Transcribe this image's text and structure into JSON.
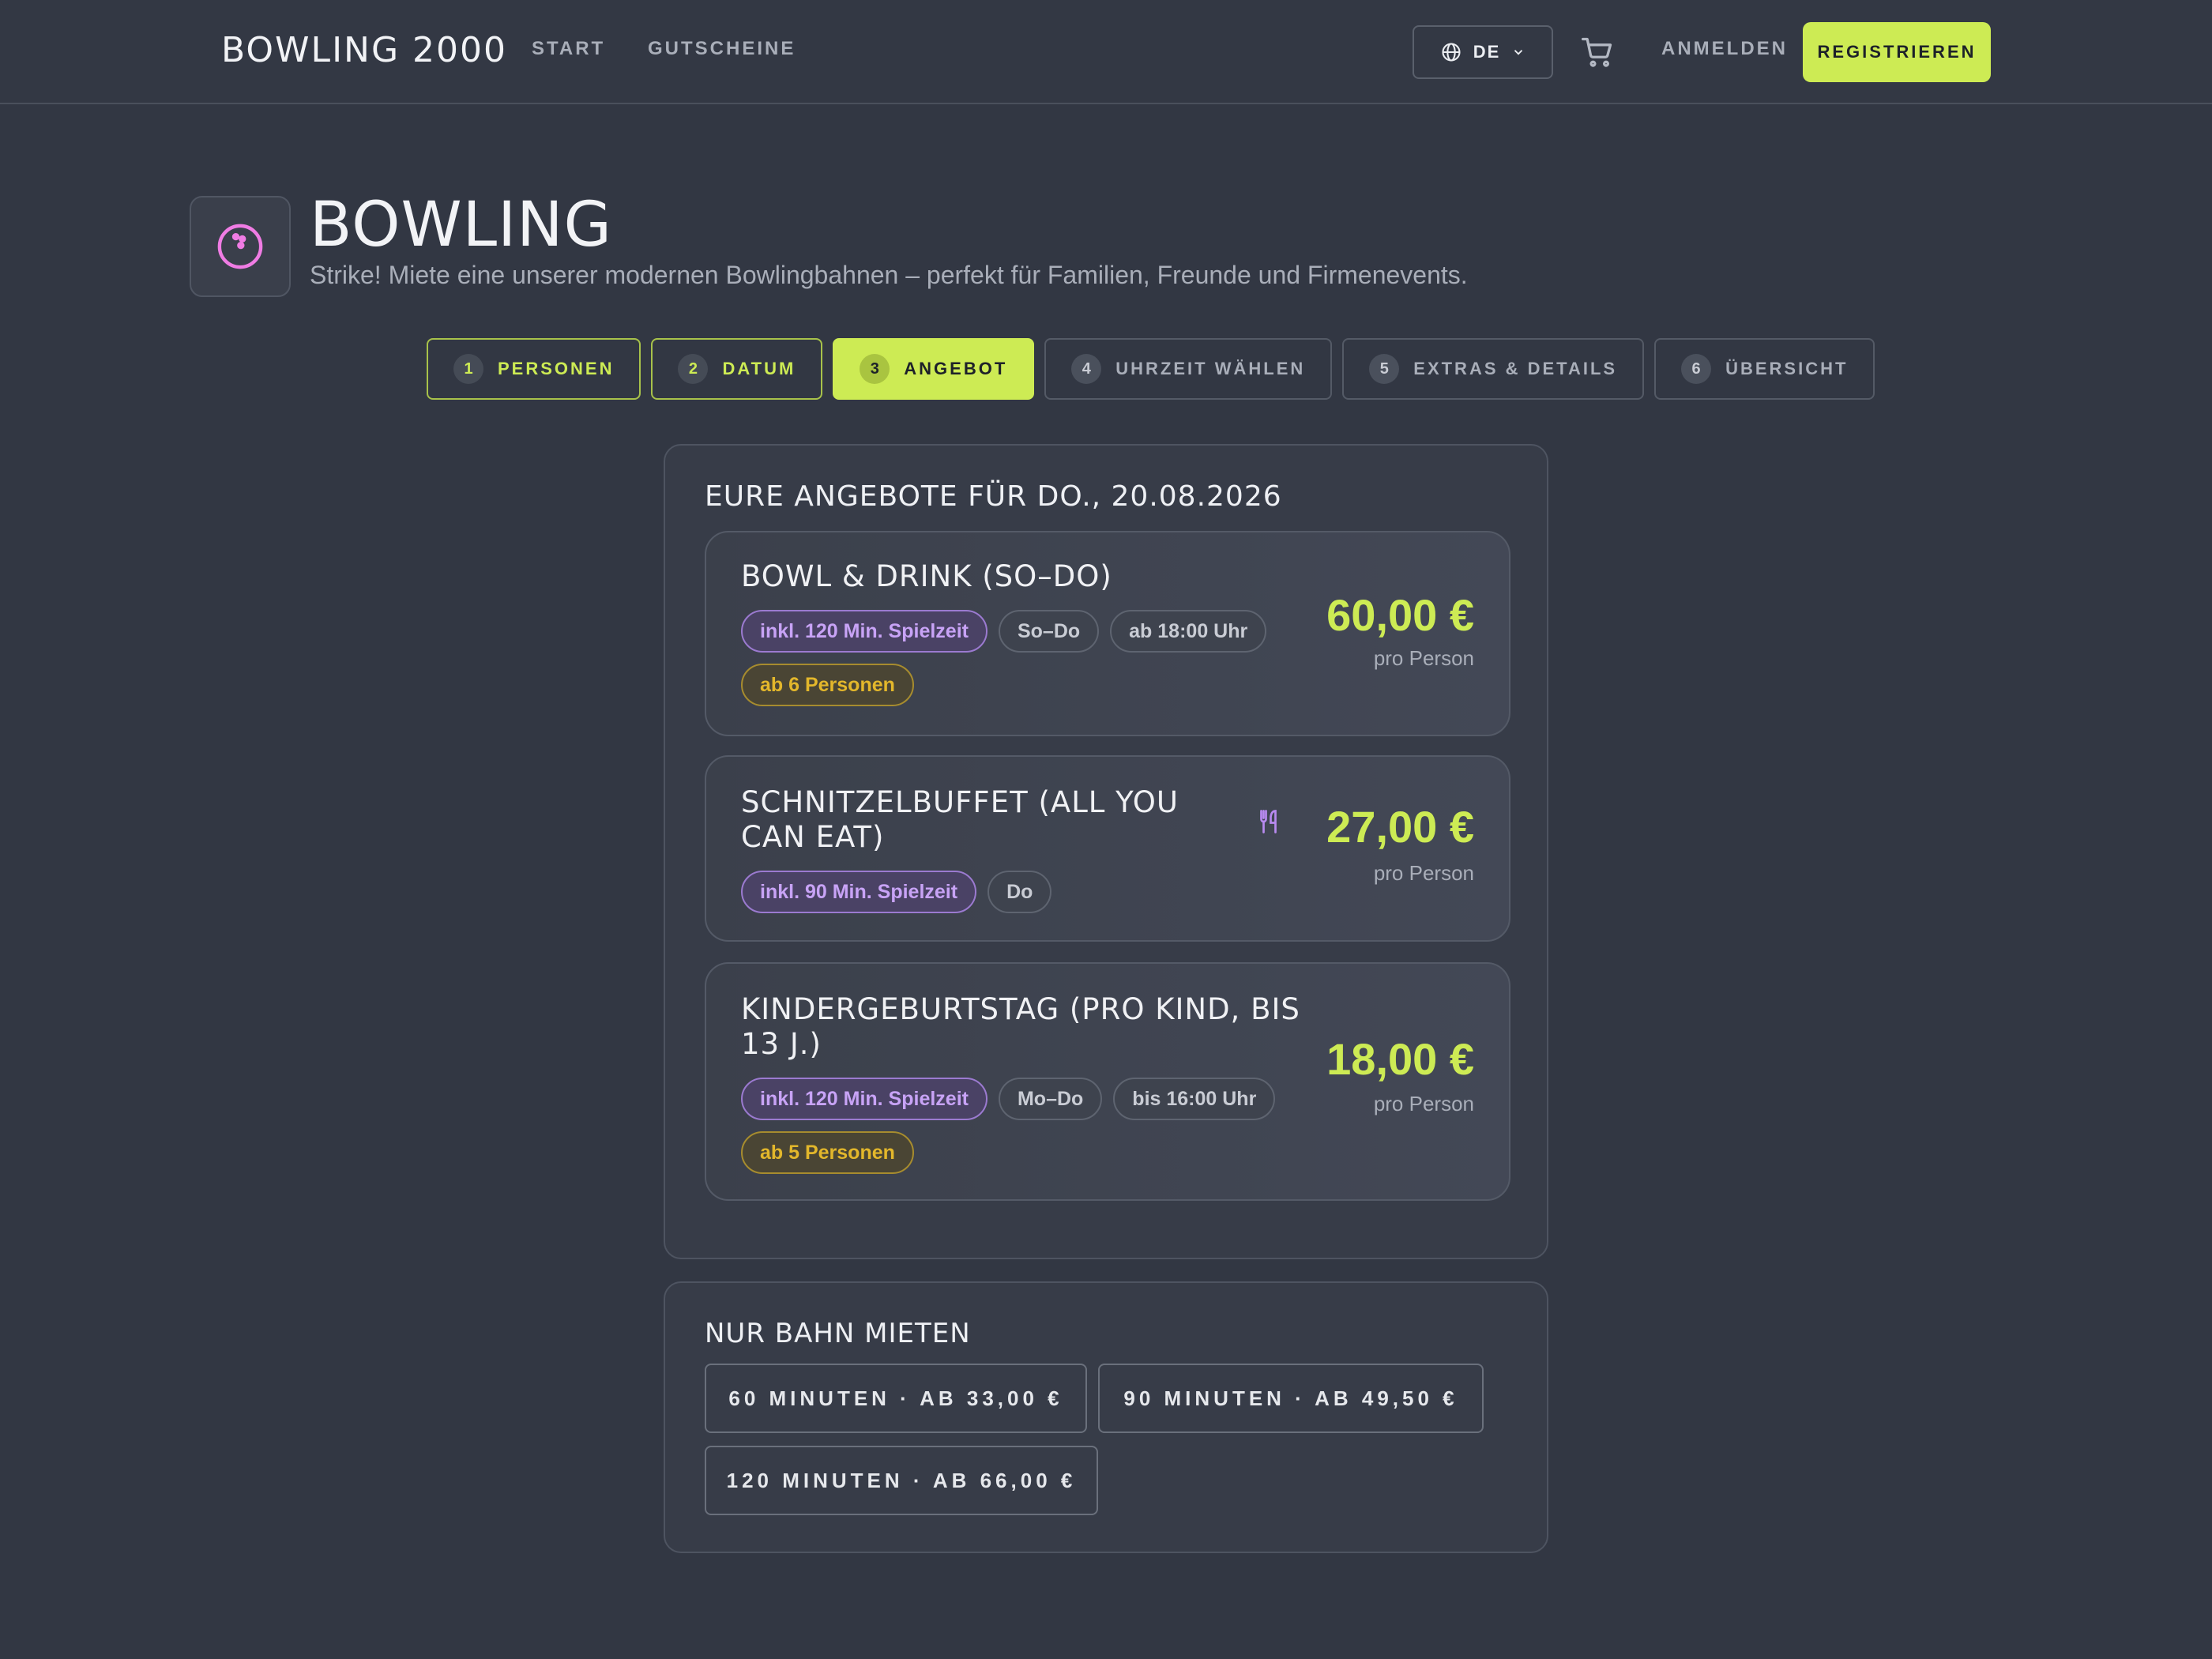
{
  "header": {
    "brand": "BOWLING 2000",
    "nav": [
      "START",
      "GUTSCHEINE"
    ],
    "language": "DE",
    "login": "ANMELDEN",
    "register": "REGISTRIEREN"
  },
  "hero": {
    "title": "BOWLING",
    "subtitle": "Strike! Miete eine unserer modernen Bowlingbahnen – perfekt für Familien, Freunde und Firmenevents."
  },
  "steps": [
    {
      "num": "1",
      "label": "PERSONEN",
      "state": "done"
    },
    {
      "num": "2",
      "label": "DATUM",
      "state": "done"
    },
    {
      "num": "3",
      "label": "ANGEBOT",
      "state": "active"
    },
    {
      "num": "4",
      "label": "UHRZEIT WÄHLEN",
      "state": "todo"
    },
    {
      "num": "5",
      "label": "EXTRAS & DETAILS",
      "state": "todo"
    },
    {
      "num": "6",
      "label": "ÜBERSICHT",
      "state": "todo"
    }
  ],
  "offers_panel": {
    "title": "EURE ANGEBOTE FÜR DO., 20.08.2026",
    "offers": [
      {
        "name": "BOWL & DRINK (SO–DO)",
        "chips": [
          "inkl. 120 Min. Spielzeit",
          "So–Do",
          "ab 18:00 Uhr",
          "ab 6 Personen"
        ],
        "price": "60,00 €",
        "per": "pro Person"
      },
      {
        "name": "SCHNITZELBUFFET (ALL YOU CAN EAT)",
        "chips": [
          "inkl. 90 Min. Spielzeit",
          "Do"
        ],
        "price": "27,00 €",
        "per": "pro Person",
        "icon": "cutlery-icon"
      },
      {
        "name": "KINDERGEBURTSTAG (PRO KIND, BIS 13 J.)",
        "chips": [
          "inkl. 120 Min. Spielzeit",
          "Mo–Do",
          "bis 16:00 Uhr",
          "ab 5 Personen"
        ],
        "price": "18,00 €",
        "per": "pro Person"
      }
    ]
  },
  "lane_panel": {
    "title": "NUR BAHN MIETEN",
    "options": [
      "60 MINUTEN · AB 33,00 €",
      "90 MINUTEN · AB 49,50 €",
      "120 MINUTEN · AB 66,00 €"
    ]
  },
  "colors": {
    "accent": "#cdeb54",
    "background": "#323743",
    "chip_purple": "#c8a3f6",
    "chip_amber": "#e3b72b"
  }
}
